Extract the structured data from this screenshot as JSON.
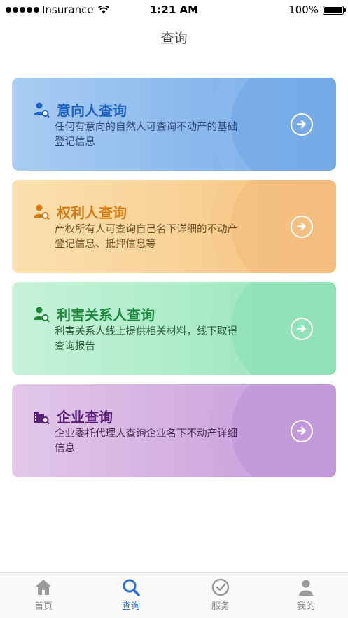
{
  "status_bar": {
    "carrier": "Insurance",
    "time": "1:21 AM",
    "battery": "100%"
  },
  "page_title": "查询",
  "cards": [
    {
      "title": "意向人查询",
      "description": "任何有意向的自然人可查询不动产的基础登记信息",
      "icon": "person-search-icon",
      "color": "#1e63c2"
    },
    {
      "title": "权利人查询",
      "description": "产权所有人可查询自己名下详细的不动产登记信息、抵押信息等",
      "icon": "person-search-icon",
      "color": "#d47a12"
    },
    {
      "title": "利害关系人查询",
      "description": "利害关系人线上提供相关材料，线下取得查询报告",
      "icon": "person-search-icon",
      "color": "#1f8a3e"
    },
    {
      "title": "企业查询",
      "description": "企业委托代理人查询企业名下不动产详细信息",
      "icon": "building-search-icon",
      "color": "#5a1f76"
    }
  ],
  "tabs": [
    {
      "label": "首页",
      "icon": "home-icon"
    },
    {
      "label": "查询",
      "icon": "search-icon",
      "active": true
    },
    {
      "label": "服务",
      "icon": "service-icon"
    },
    {
      "label": "我的",
      "icon": "user-icon"
    }
  ]
}
